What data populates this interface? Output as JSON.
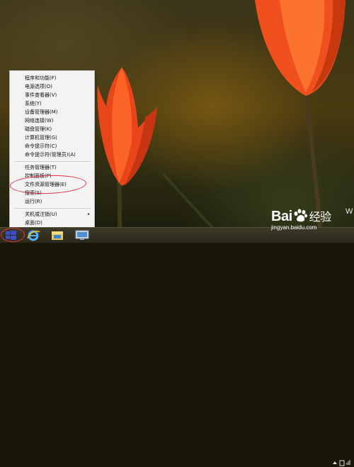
{
  "menu": {
    "items": [
      {
        "label": "程序和功能(F)"
      },
      {
        "label": "电源选项(O)"
      },
      {
        "label": "事件查看器(V)"
      },
      {
        "label": "系统(Y)"
      },
      {
        "label": "设备管理器(M)"
      },
      {
        "label": "网络连接(W)"
      },
      {
        "label": "磁盘管理(K)"
      },
      {
        "label": "计算机管理(G)"
      },
      {
        "label": "命令提示符(C)"
      },
      {
        "label": "命令提示符(管理员)(A)"
      },
      {
        "label": "任务管理器(T)"
      },
      {
        "label": "控制面板(P)"
      },
      {
        "label": "文件资源管理器(E)"
      },
      {
        "label": "搜索(S)"
      },
      {
        "label": "运行(R)"
      },
      {
        "label": "关机或注销(U)",
        "submenu_arrow": "▸"
      },
      {
        "label": "桌面(D)"
      }
    ],
    "highlighted_item": "文件资源管理器(E)"
  },
  "taskbar": {
    "buttons": [
      {
        "name": "start",
        "icon": "windows-logo-icon"
      },
      {
        "name": "internet-explorer",
        "icon": "ie-icon"
      },
      {
        "name": "file-explorer",
        "icon": "folder-icon"
      },
      {
        "name": "computer",
        "icon": "computer-icon"
      }
    ]
  },
  "watermark": {
    "logo_text": "Bai",
    "logo_text_after": "经验",
    "url": "jingyan.baidu.com",
    "corner_letter": "W"
  },
  "colors": {
    "annotation": "#e0314a",
    "menu_bg": "#f3f3f3",
    "taskbar": "#2f2c1c",
    "start_blue": "#3a4fc7"
  }
}
